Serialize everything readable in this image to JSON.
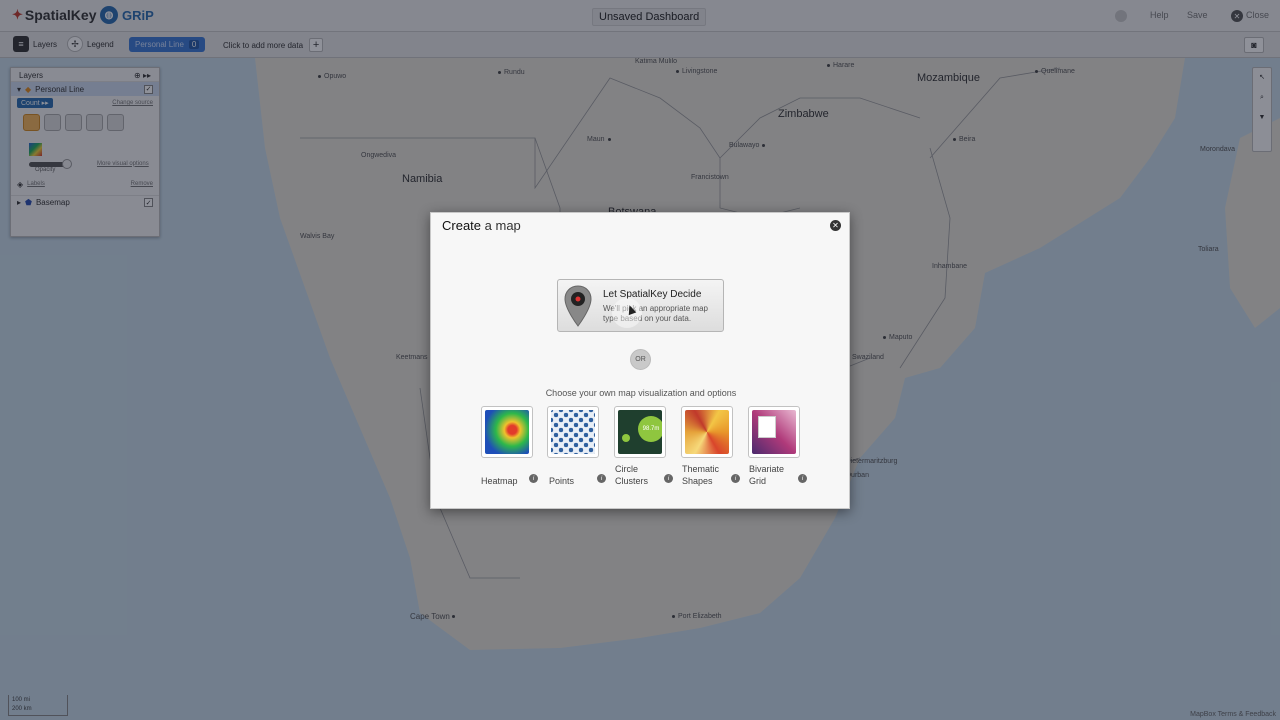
{
  "header": {
    "logo": "SpatialKey",
    "partner": "GRiP",
    "title": "Unsaved Dashboard",
    "links": [
      "Help",
      "Save"
    ],
    "close": "Close"
  },
  "toolbar": {
    "layers": "Layers",
    "legend": "Legend",
    "dataset": "Personal Line",
    "dataset_count": "0",
    "add_data": "Click to add more data"
  },
  "layers_panel": {
    "title": "Layers",
    "layer1": "Personal Line",
    "count_btn": "Count ▸▸",
    "change_source": "Change source",
    "opacity": "Opacity",
    "more_options": "More visual options",
    "labels": "Labels",
    "remove": "Remove",
    "layer2": "Basemap"
  },
  "right_tools": [
    "Select",
    "Zoom",
    "Filter"
  ],
  "map": {
    "countries": [
      "Mozambique",
      "Zimbabwe",
      "Namibia",
      "Botswana"
    ],
    "places": [
      "Opuwo",
      "Rundu",
      "Katima Mulilo",
      "Livingstone",
      "Harare",
      "Quelimane",
      "Maun",
      "Bulawayo",
      "Beira",
      "Morondava",
      "Ongwediva",
      "Francistown",
      "Walvis Bay",
      "Inhambane",
      "Toliara",
      "Keetmans",
      "Maputo",
      "Swaziland",
      "Pietermaritzburg",
      "Durban",
      "Cape Town",
      "Port Elizabeth"
    ],
    "attribution": "MapBox Terms & Feedback",
    "scale": [
      "100 mi",
      "200 km"
    ]
  },
  "modal": {
    "title_bold": "Create",
    "title_rest": "a map",
    "decide_title": "Let SpatialKey Decide",
    "decide_sub": "We'll pick an appropriate map type based on your data.",
    "or": "OR",
    "choose": "Choose your own map visualization and options",
    "options": [
      {
        "label": "Heatmap"
      },
      {
        "label": "Points"
      },
      {
        "label": "Circle Clusters",
        "badge": "98.7m"
      },
      {
        "label": "Thematic Shapes"
      },
      {
        "label": "Bivariate Grid"
      }
    ]
  }
}
